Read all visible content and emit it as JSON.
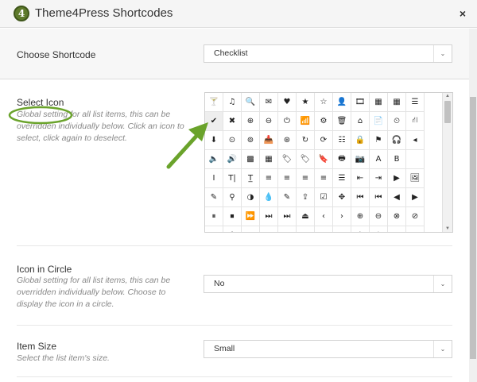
{
  "dialog": {
    "logo_text": "4",
    "title": "Theme4Press Shortcodes",
    "close_glyph": "×"
  },
  "choose_shortcode": {
    "label": "Choose Shortcode",
    "value": "Checklist",
    "chevron": "⌄"
  },
  "select_icon": {
    "label": "Select Icon",
    "description": "Global setting for all list items, this can be overridden individually below. Click an icon to select, click again to deselect.",
    "icons": [
      "🍸",
      "♫",
      "🔍",
      "✉",
      "♥",
      "★",
      "☆",
      "👤",
      "🎞",
      "▦",
      "▦",
      "☰",
      "✔",
      "✖",
      "⊕",
      "⊖",
      "⏻",
      "📶",
      "⚙",
      "🗑",
      "⌂",
      "📄",
      "⏲",
      "⛙",
      "⬇",
      "⊙",
      "⊚",
      "📥",
      "⊛",
      "↻",
      "⟳",
      "☷",
      "🔒",
      "⚑",
      "🎧",
      "◂",
      "🔈",
      "🔊",
      "▩",
      "▦",
      "🏷",
      "🏷",
      "🔖",
      "🖶",
      "📷",
      "A",
      "B",
      "",
      "I",
      "T|",
      "T̲",
      "≡",
      "≡",
      "≡",
      "≡",
      "☰",
      "⇤",
      "⇥",
      "▶",
      "🖼",
      "✎",
      "⚲",
      "◑",
      "💧",
      "✎",
      "⇪",
      "☑",
      "✥",
      "⏮",
      "⏮",
      "◀",
      "▶",
      "⏸",
      "⏹",
      "⏩",
      "⏭",
      "⏭",
      "⏏",
      "‹",
      "›",
      "⊕",
      "⊖",
      "⊗",
      "⊘",
      "?",
      "i",
      "⌖",
      "⊗",
      "⊘",
      "⊘",
      "←",
      "→",
      "↑",
      "↓",
      "↪",
      "⤢"
    ],
    "selected_index": 12
  },
  "icon_in_circle": {
    "label": "Icon in Circle",
    "description": "Global setting for all list items, this can be overridden individually below. Choose to display the icon in a circle.",
    "value": "No",
    "chevron": "⌄"
  },
  "item_size": {
    "label": "Item Size",
    "description": "Select the list item's size.",
    "value": "Small",
    "chevron": "⌄"
  },
  "colors": {
    "annotation": "#6aa32b",
    "logo": "#5e7a2b"
  }
}
